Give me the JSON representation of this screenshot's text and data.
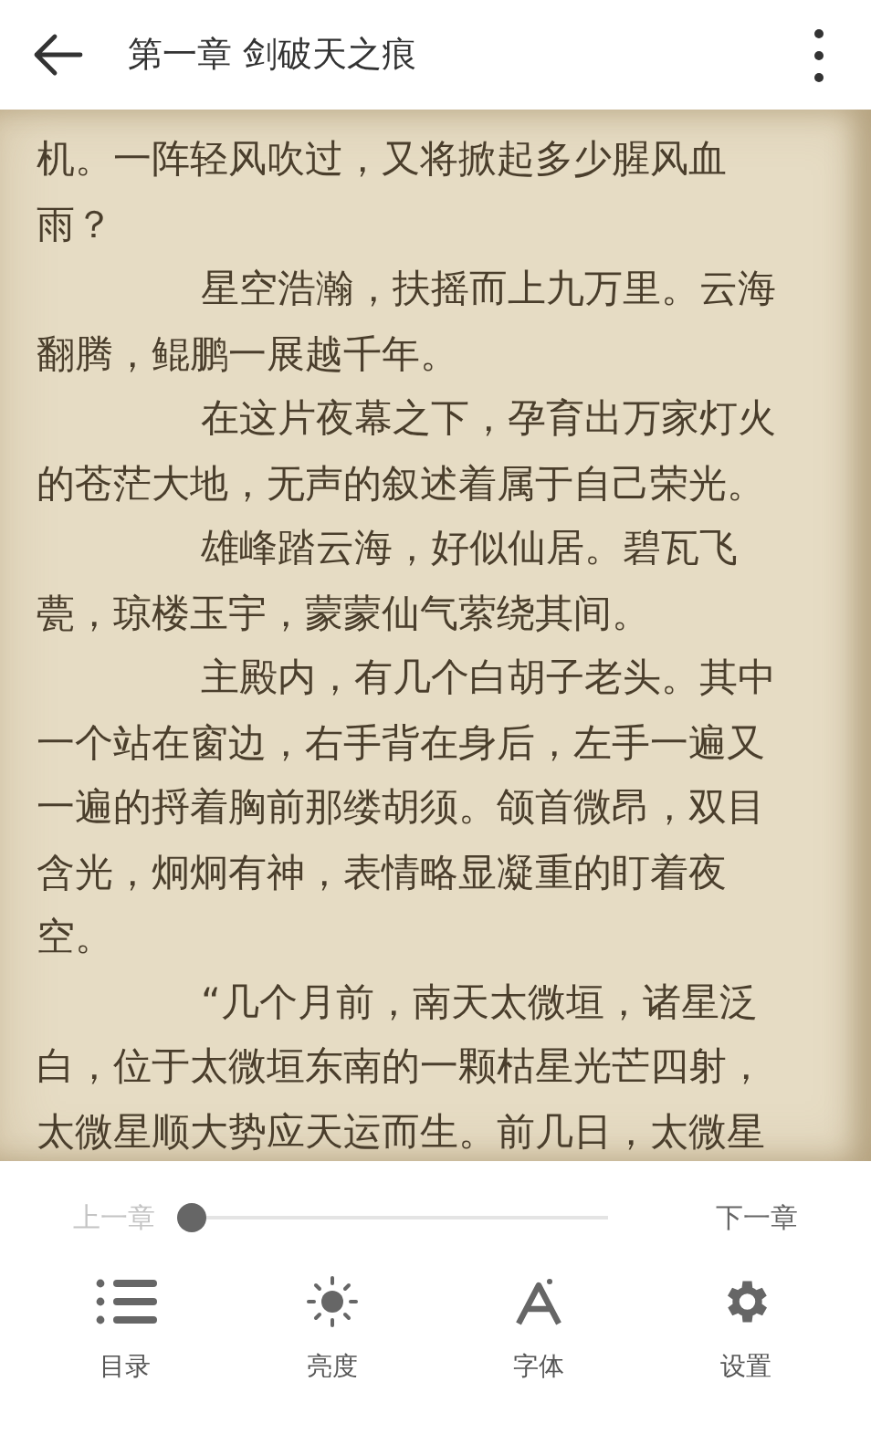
{
  "header": {
    "title": "第一章 剑破天之痕"
  },
  "paragraphs": [
    {
      "kind": "continued",
      "lines": [
        "机。一阵轻风吹过，又将掀起多少腥风血",
        "雨？"
      ]
    },
    {
      "kind": "indented",
      "lines": [
        "星空浩瀚，扶摇而上九万里。云海",
        "翻腾，鲲鹏一展越千年。"
      ]
    },
    {
      "kind": "indented",
      "lines": [
        "在这片夜幕之下，孕育出万家灯火",
        "的苍茫大地，无声的叙述着属于自己荣光。"
      ]
    },
    {
      "kind": "indented",
      "lines": [
        "雄峰踏云海，好似仙居。碧瓦飞",
        "甍，琼楼玉宇，蒙蒙仙气萦绕其间。"
      ]
    },
    {
      "kind": "indented",
      "lines": [
        "主殿内，有几个白胡子老头。其中",
        "一个站在窗边，右手背在身后，左手一遍又",
        "一遍的捋着胸前那缕胡须。颌首微昂，双目",
        "含光，炯炯有神，表情略显凝重的盯着夜",
        "空。"
      ]
    },
    {
      "kind": "indented",
      "lines": [
        "“几个月前，南天太微垣，诸星泛",
        "白，位于太微垣东南的一颗枯星光芒四射，",
        "太微星顺大势应天运而生。前几日，太微星"
      ]
    }
  ],
  "chapter_nav": {
    "prev": {
      "label": "上一章",
      "disabled": true
    },
    "next": {
      "label": "下一章",
      "disabled": false
    },
    "progress": {
      "level": 0
    }
  },
  "toolbar": [
    {
      "kind": "contents",
      "label": "目录"
    },
    {
      "kind": "brightness",
      "label": "亮度"
    },
    {
      "kind": "font",
      "label": "字体"
    },
    {
      "kind": "settings",
      "label": "设置"
    }
  ]
}
